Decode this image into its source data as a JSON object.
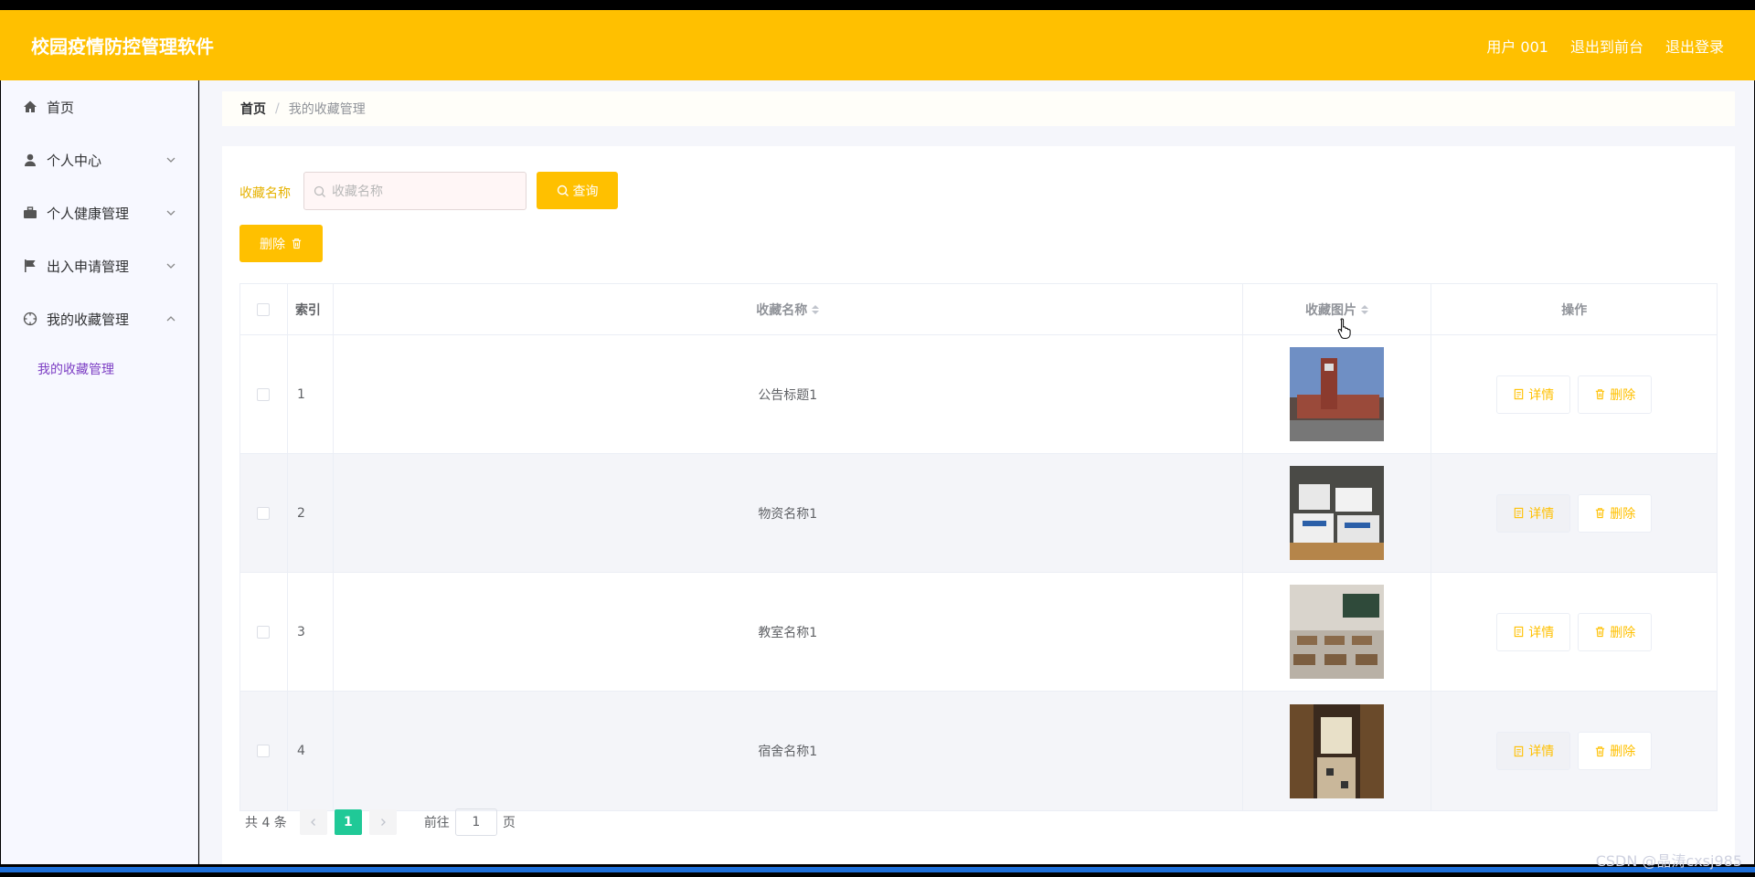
{
  "app": {
    "title": "校园疫情防控管理软件"
  },
  "header": {
    "nav": [
      "用户 001",
      "退出到前台",
      "退出登录"
    ]
  },
  "sidebar": {
    "items": [
      {
        "label": "首页",
        "icon": "home-icon",
        "expandable": false
      },
      {
        "label": "个人中心",
        "icon": "user-icon",
        "expandable": true
      },
      {
        "label": "个人健康管理",
        "icon": "briefcase-icon",
        "expandable": true
      },
      {
        "label": "出入申请管理",
        "icon": "flag-icon",
        "expandable": true
      },
      {
        "label": "我的收藏管理",
        "icon": "compass-icon",
        "expandable": true,
        "expanded": true
      }
    ],
    "submenu": [
      "我的收藏管理"
    ]
  },
  "breadcrumb": {
    "home": "首页",
    "separator": "/",
    "current": "我的收藏管理"
  },
  "search": {
    "label": "收藏名称",
    "placeholder": "收藏名称",
    "button": "查询"
  },
  "actions": {
    "delete": "删除"
  },
  "table": {
    "headers": [
      "索引",
      "收藏名称",
      "收藏图片",
      "操作"
    ],
    "rows": [
      {
        "index": "1",
        "name": "公告标题1",
        "image": "campus-building"
      },
      {
        "index": "2",
        "name": "物资名称1",
        "image": "supply-boxes"
      },
      {
        "index": "3",
        "name": "教室名称1",
        "image": "classroom"
      },
      {
        "index": "4",
        "name": "宿舍名称1",
        "image": "dormitory"
      }
    ],
    "row_actions": {
      "detail": "详情",
      "delete": "删除"
    }
  },
  "pagination": {
    "total": "共 4 条",
    "current_page": "1",
    "goto_label": "前往",
    "goto_value": "1",
    "page_suffix": "页"
  },
  "watermark": "CSDN @晶涛cxsj985",
  "colors": {
    "primary": "#ffc000",
    "page_active": "#20c997",
    "submenu_active": "#7d3fc4"
  }
}
